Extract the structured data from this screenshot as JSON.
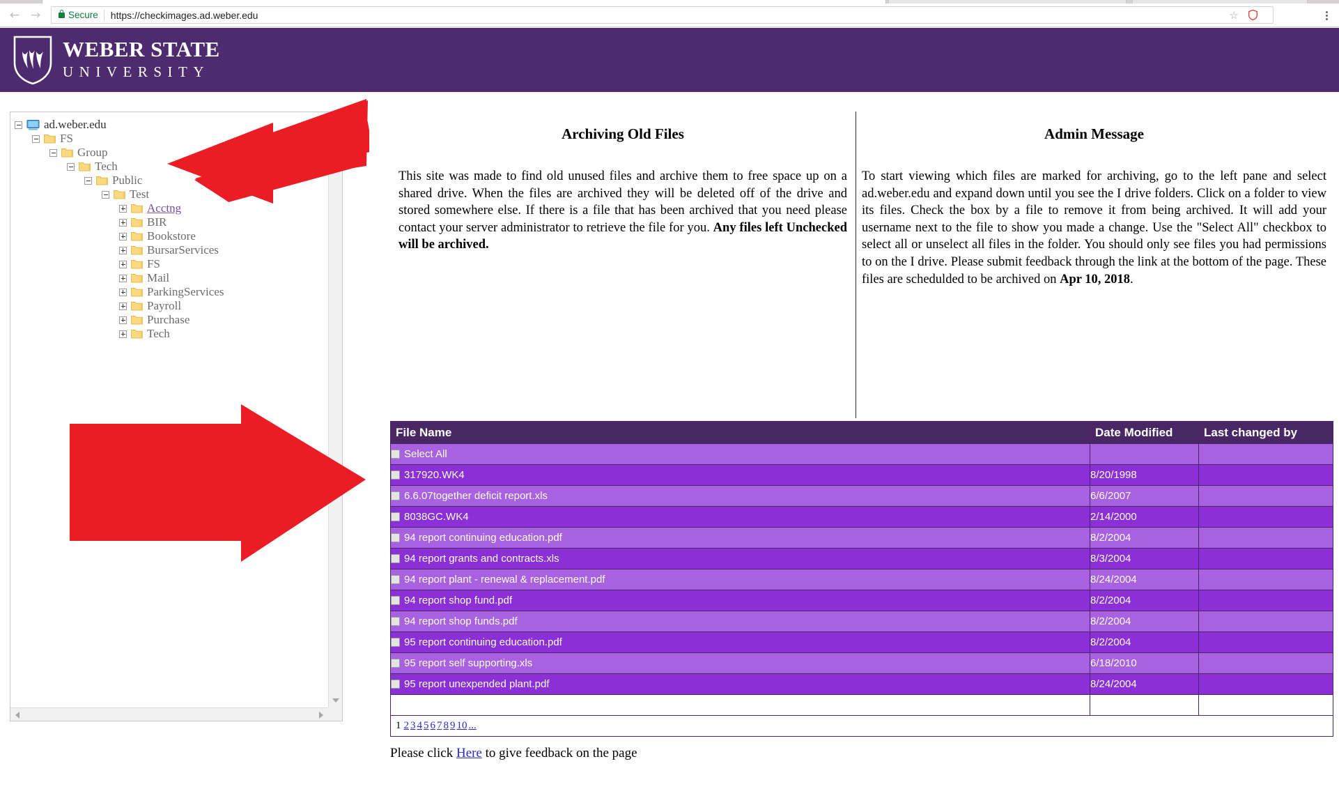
{
  "browser": {
    "back_icon": "back-arrow-icon",
    "forward_icon": "forward-arrow-icon",
    "reload_icon": "reload-icon",
    "secure_label": "Secure",
    "url": "https://checkimages.ad.weber.edu",
    "star_icon": "bookmark-star-icon",
    "extension_icon": "shield-extension-icon",
    "menu_icon": "chrome-menu-icon"
  },
  "header": {
    "logo_icon": "weber-state-shield-icon",
    "wordmark_line1": "WEBER STATE",
    "wordmark_line2": "UNIVERSITY",
    "band_color": "#4e2a6e"
  },
  "tree": {
    "root_icon": "monitor-icon",
    "folder_icon": "folder-icon",
    "items": [
      {
        "label": "ad.weber.edu",
        "depth": 0,
        "toggle": "minus",
        "icon": "monitor-icon",
        "state": "root"
      },
      {
        "label": "FS",
        "depth": 1,
        "toggle": "minus",
        "icon": "folder-icon",
        "state": "normal"
      },
      {
        "label": "Group",
        "depth": 2,
        "toggle": "minus",
        "icon": "folder-icon",
        "state": "normal"
      },
      {
        "label": "Tech",
        "depth": 3,
        "toggle": "minus",
        "icon": "folder-icon",
        "state": "normal"
      },
      {
        "label": "Public",
        "depth": 4,
        "toggle": "minus",
        "icon": "folder-icon",
        "state": "normal"
      },
      {
        "label": "Test",
        "depth": 5,
        "toggle": "minus",
        "icon": "folder-icon",
        "state": "normal"
      },
      {
        "label": "Acctng",
        "depth": 6,
        "toggle": "plus",
        "icon": "folder-icon",
        "state": "selected"
      },
      {
        "label": "BIR",
        "depth": 6,
        "toggle": "plus",
        "icon": "folder-icon",
        "state": "normal"
      },
      {
        "label": "Bookstore",
        "depth": 6,
        "toggle": "plus",
        "icon": "folder-icon",
        "state": "normal"
      },
      {
        "label": "BursarServices",
        "depth": 6,
        "toggle": "plus",
        "icon": "folder-icon",
        "state": "normal"
      },
      {
        "label": "FS",
        "depth": 6,
        "toggle": "plus",
        "icon": "folder-icon",
        "state": "normal"
      },
      {
        "label": "Mail",
        "depth": 6,
        "toggle": "plus",
        "icon": "folder-icon",
        "state": "normal"
      },
      {
        "label": "ParkingServices",
        "depth": 6,
        "toggle": "plus",
        "icon": "folder-icon",
        "state": "normal"
      },
      {
        "label": "Payroll",
        "depth": 6,
        "toggle": "plus",
        "icon": "folder-icon",
        "state": "normal"
      },
      {
        "label": "Purchase",
        "depth": 6,
        "toggle": "plus",
        "icon": "folder-icon",
        "state": "normal"
      },
      {
        "label": "Tech",
        "depth": 6,
        "toggle": "plus",
        "icon": "folder-icon",
        "state": "normal"
      }
    ]
  },
  "annotations": {
    "arrow_1": "red-arrow-icon",
    "arrow_2": "red-arrow-icon",
    "arrow_color": "#ec1c24"
  },
  "info_left": {
    "title": "Archiving Old Files",
    "para_1": "This site was made to find old unused files and archive them to free space up on a shared drive. When the files are archived they will be deleted off of the drive and stored somewhere else. If there is a file that has been archived that you need please contact your server administrator to retrieve the file for you. ",
    "para_1_bold": "Any files left Unchecked will be archived."
  },
  "info_right": {
    "title": "Admin Message",
    "para_1": "To start viewing which files are marked for archiving, go to the left pane and select ad.weber.edu and expand down until you see the I drive folders. Click on a folder to view its files. Check the box by a file to remove it from being archived. It will add your username next to the file to show you made a change. Use the \"Select All\" checkbox to select all or unselect all files in the folder. You should only see files you had permissions to on the I drive. Please submit feedback through the link at the bottom of the page. These files are schedulded to be archived on ",
    "para_1_bold": "Apr 10, 2018",
    "para_1_tail": "."
  },
  "table": {
    "headers": [
      "File Name",
      "Date Modified",
      "Last changed by"
    ],
    "select_all_label": "Select All",
    "checkbox_icon": "checkbox-unchecked-icon",
    "header_color": "#492764",
    "row_light_color": "#a861e0",
    "row_dark_color": "#8b2fd6",
    "rows": [
      {
        "name": "317920.WK4",
        "date": "8/20/1998",
        "user": ""
      },
      {
        "name": "6.6.07together deficit report.xls",
        "date": "6/6/2007",
        "user": ""
      },
      {
        "name": "8038GC.WK4",
        "date": "2/14/2000",
        "user": ""
      },
      {
        "name": "94 report continuing education.pdf",
        "date": "8/2/2004",
        "user": ""
      },
      {
        "name": "94 report grants and contracts.xls",
        "date": "8/3/2004",
        "user": ""
      },
      {
        "name": "94 report plant - renewal & replacement.pdf",
        "date": "8/24/2004",
        "user": ""
      },
      {
        "name": "94 report shop fund.pdf",
        "date": "8/2/2004",
        "user": ""
      },
      {
        "name": "94 report shop funds.pdf",
        "date": "8/2/2004",
        "user": ""
      },
      {
        "name": "95 report continuing education.pdf",
        "date": "8/2/2004",
        "user": ""
      },
      {
        "name": "95 report self supporting.xls",
        "date": "6/18/2010",
        "user": ""
      },
      {
        "name": "95 report unexpended plant.pdf",
        "date": "8/24/2004",
        "user": ""
      }
    ]
  },
  "pagination": {
    "current": "1",
    "pages": [
      "2",
      "3",
      "4",
      "5",
      "6",
      "7",
      "8",
      "9",
      "10",
      "..."
    ]
  },
  "footer": {
    "prefix": "Please click ",
    "link": "Here",
    "suffix": " to give feedback on the page"
  }
}
